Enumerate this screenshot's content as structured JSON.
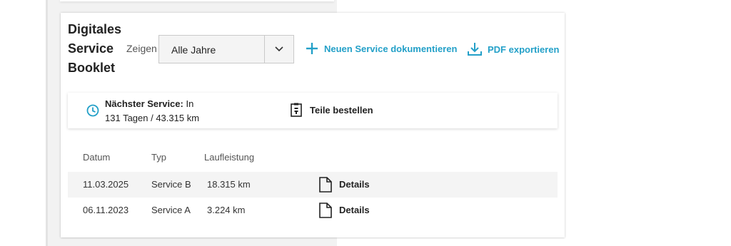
{
  "booklet": {
    "title_lines": [
      "Digitales",
      "Service",
      "Booklet"
    ],
    "show_label": "Zeigen",
    "year_select": {
      "value": "Alle Jahre"
    },
    "actions": {
      "add_service": "Neuen Service dokumentieren",
      "export_pdf": "PDF exportieren"
    },
    "accent_color": "#23a0c8"
  },
  "next_service": {
    "label": "Nächster Service:",
    "text_line1": "In",
    "text_line2": "131 Tagen / 43.315 km",
    "order_parts": "Teile bestellen"
  },
  "table": {
    "headers": [
      "Datum",
      "Typ",
      "Laufleistung"
    ],
    "rows": [
      {
        "date": "11.03.2025",
        "type": "Service B",
        "mileage": "18.315 km",
        "details": "Details"
      },
      {
        "date": "06.11.2023",
        "type": "Service A",
        "mileage": "3.224 km",
        "details": "Details"
      }
    ]
  }
}
